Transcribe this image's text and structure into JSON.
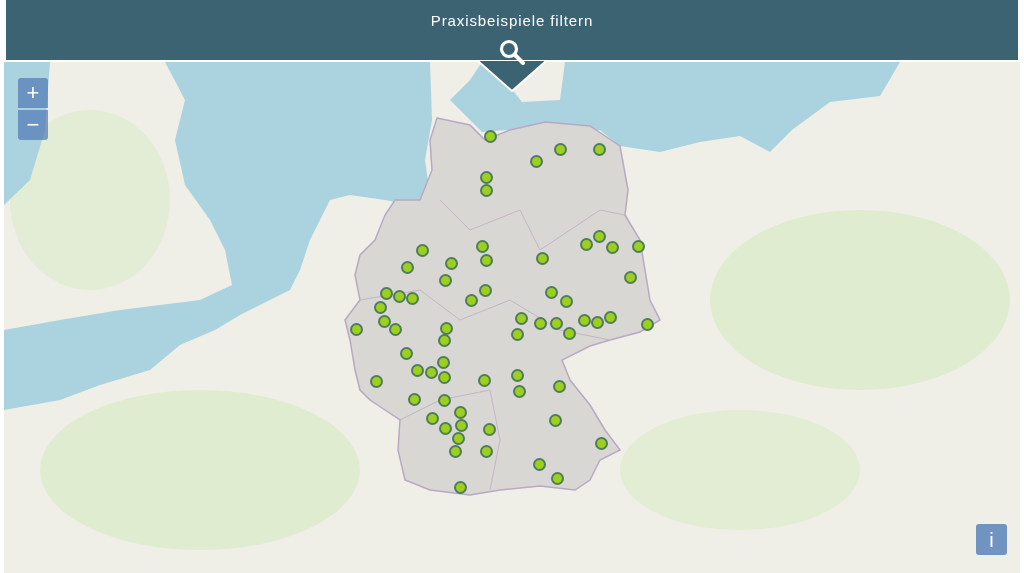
{
  "filter_bar": {
    "title": "Praxisbeispiele filtern"
  },
  "map": {
    "zoom_in": "+",
    "zoom_out": "−",
    "info_button": "i"
  }
}
